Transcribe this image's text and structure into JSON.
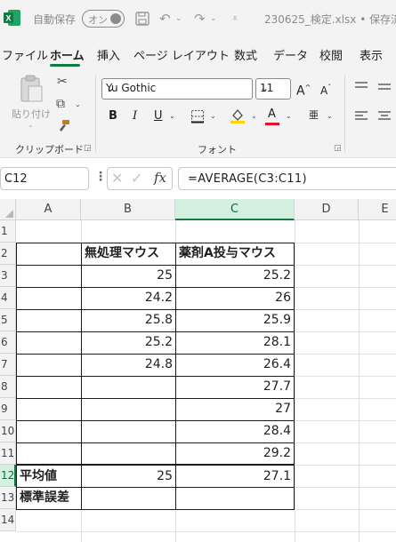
{
  "titlebar": {
    "autosave_label": "自動保存",
    "autosave_toggle": "オン",
    "document_title": "230625_検定.xlsx • 保存済"
  },
  "ribbon_tabs": [
    "ファイル",
    "ホーム",
    "挿入",
    "ページ レイアウト",
    "数式",
    "データ",
    "校閲",
    "表示"
  ],
  "active_tab": "ホーム",
  "ribbon": {
    "paste_label": "貼り付け",
    "clipboard_group": "クリップボード",
    "font_group": "フォント",
    "font_name": "Yu Gothic",
    "font_size": "11"
  },
  "formula_bar": {
    "name_box": "C12",
    "formula": "=AVERAGE(C3:C11)"
  },
  "sheet": {
    "column_headers": [
      "A",
      "B",
      "C",
      "D",
      "E"
    ],
    "row_headers": [
      "1",
      "2",
      "3",
      "4",
      "5",
      "6",
      "7",
      "8",
      "9",
      "10",
      "11",
      "12",
      "13",
      "14"
    ],
    "active_column": "C",
    "active_row": "12",
    "header_row": [
      "",
      "無処理マウス",
      "薬剤A投与マウス"
    ],
    "data_b": [
      "25",
      "24.2",
      "25.8",
      "25.2",
      "24.8"
    ],
    "data_c": [
      "25.2",
      "26",
      "25.9",
      "28.1",
      "26.4",
      "27.7",
      "27",
      "28.4",
      "29.2"
    ],
    "average_label": "平均値",
    "average_b": "25",
    "average_c": "27.1",
    "stderr_label": "標準誤差"
  },
  "colors": {
    "excel_green": "#107c41",
    "font_color_red": "#e81123",
    "highlight_yellow": "#ffd400"
  }
}
